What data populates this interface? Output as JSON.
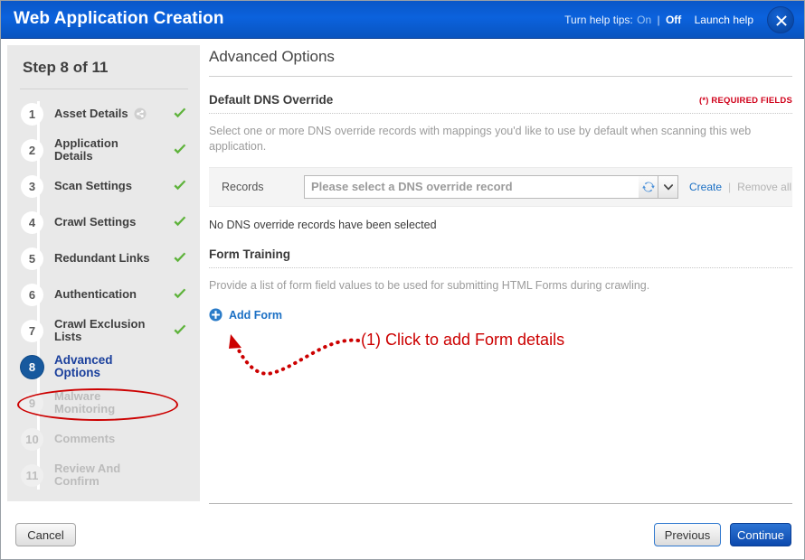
{
  "titlebar": {
    "title": "Web Application Creation",
    "help_label": "Turn help tips:",
    "help_on": "On",
    "help_separator": "|",
    "help_off": "Off",
    "launch_help": "Launch help",
    "close_icon": "close-icon",
    "accent_color": "#0b62dd"
  },
  "sidebar": {
    "heading": "Step 8 of 11",
    "steps": [
      {
        "num": "1",
        "label": "Asset Details",
        "state": "complete",
        "checked": true,
        "extra_icon": "share-icon"
      },
      {
        "num": "2",
        "label": "Application Details",
        "state": "complete",
        "checked": true
      },
      {
        "num": "3",
        "label": "Scan Settings",
        "state": "complete",
        "checked": true
      },
      {
        "num": "4",
        "label": "Crawl Settings",
        "state": "complete",
        "checked": true
      },
      {
        "num": "5",
        "label": "Redundant Links",
        "state": "complete",
        "checked": true
      },
      {
        "num": "6",
        "label": "Authentication",
        "state": "complete",
        "checked": true
      },
      {
        "num": "7",
        "label": "Crawl Exclusion Lists",
        "state": "complete",
        "checked": true
      },
      {
        "num": "8",
        "label": "Advanced Options",
        "state": "active",
        "checked": false
      },
      {
        "num": "9",
        "label": "Malware Monitoring",
        "state": "disabled",
        "checked": false
      },
      {
        "num": "10",
        "label": "Comments",
        "state": "disabled",
        "checked": false
      },
      {
        "num": "11",
        "label": "Review And Confirm",
        "state": "disabled",
        "checked": false
      }
    ],
    "active_color": "#17599e",
    "check_color": "#5fb33c"
  },
  "main": {
    "page_title": "Advanced Options",
    "dns_section": {
      "heading": "Default DNS Override",
      "required_note": "(*) REQUIRED FIELDS",
      "description": "Select one or more DNS override records with mappings you'd like to use by default when scanning this web application.",
      "records_label": "Records",
      "records_placeholder": "Please select a DNS override record",
      "records_value": "",
      "refresh_icon": "refresh-icon",
      "caret_icon": "chevron-down-icon",
      "create_link": "Create",
      "separator": "|",
      "remove_all_link": "Remove all",
      "empty_message": "No DNS override records have been selected"
    },
    "form_training": {
      "heading": "Form Training",
      "description": "Provide a list of form field values to be used for submitting HTML Forms during crawling.",
      "add_form_label": "Add Form",
      "add_icon": "plus-circle-icon"
    }
  },
  "annotation": {
    "text": "(1) Click to add Form details",
    "color": "#cc0000",
    "arrow_icon": "curved-arrow-icon",
    "highlight_icon": "ellipse-highlight"
  },
  "footer": {
    "cancel_label": "Cancel",
    "previous_label": "Previous",
    "continue_label": "Continue"
  }
}
